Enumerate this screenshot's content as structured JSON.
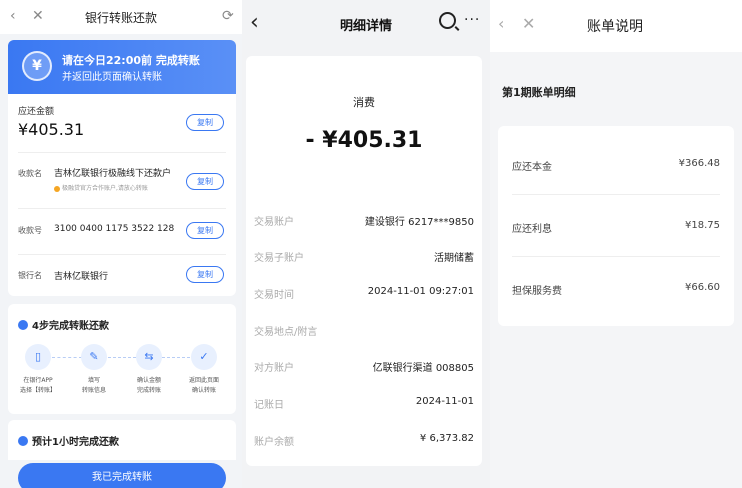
{
  "panel1": {
    "title": "银行转账还款",
    "banner": {
      "icon": "¥",
      "line1": "请在今日22:00前 完成转账",
      "line2": "并返回此页面确认转账"
    },
    "amount_label": "应还金额",
    "amount_value": "¥405.31",
    "copy_label": "复制",
    "payee_label": "收款名",
    "payee_value": "吉林亿联银行极融线下还款户",
    "payee_note": "极融贷官方合作账户,请放心转账",
    "account_label": "收款号",
    "account_value": "3100 0400 1175 3522 128",
    "bank_label": "银行名",
    "bank_value": "吉林亿联银行",
    "steps_title": "4步完成转账还款",
    "steps": [
      {
        "line1": "在银行APP",
        "line2": "选择【转账】"
      },
      {
        "line1": "填写",
        "line2": "转账信息"
      },
      {
        "line1": "确认金额",
        "line2": "完成转账"
      },
      {
        "line1": "返回此页面",
        "line2": "确认转账"
      }
    ],
    "estimate_title": "预计1小时完成还款",
    "done_button": "我已完成转账"
  },
  "panel2": {
    "title": "明细详情",
    "category": "消费",
    "amount": "- ¥405.31",
    "details": [
      {
        "label": "交易账户",
        "value": "建设银行 6217***9850"
      },
      {
        "label": "交易子账户",
        "value": "活期储蓄"
      },
      {
        "label": "交易时间",
        "value": "2024-11-01 09:27:01"
      },
      {
        "label": "交易地点/附言",
        "value": ""
      },
      {
        "label": "对方账户",
        "value": "亿联银行渠道 008805"
      },
      {
        "label": "记账日",
        "value": "2024-11-01"
      },
      {
        "label": "账户余额",
        "value": "¥ 6,373.82"
      }
    ]
  },
  "panel3": {
    "title": "账单说明",
    "section_title": "第1期账单明细",
    "items": [
      {
        "label": "应还本金",
        "value": "¥366.48"
      },
      {
        "label": "应还利息",
        "value": "¥18.75"
      },
      {
        "label": "担保服务费",
        "value": "¥66.60"
      }
    ]
  }
}
